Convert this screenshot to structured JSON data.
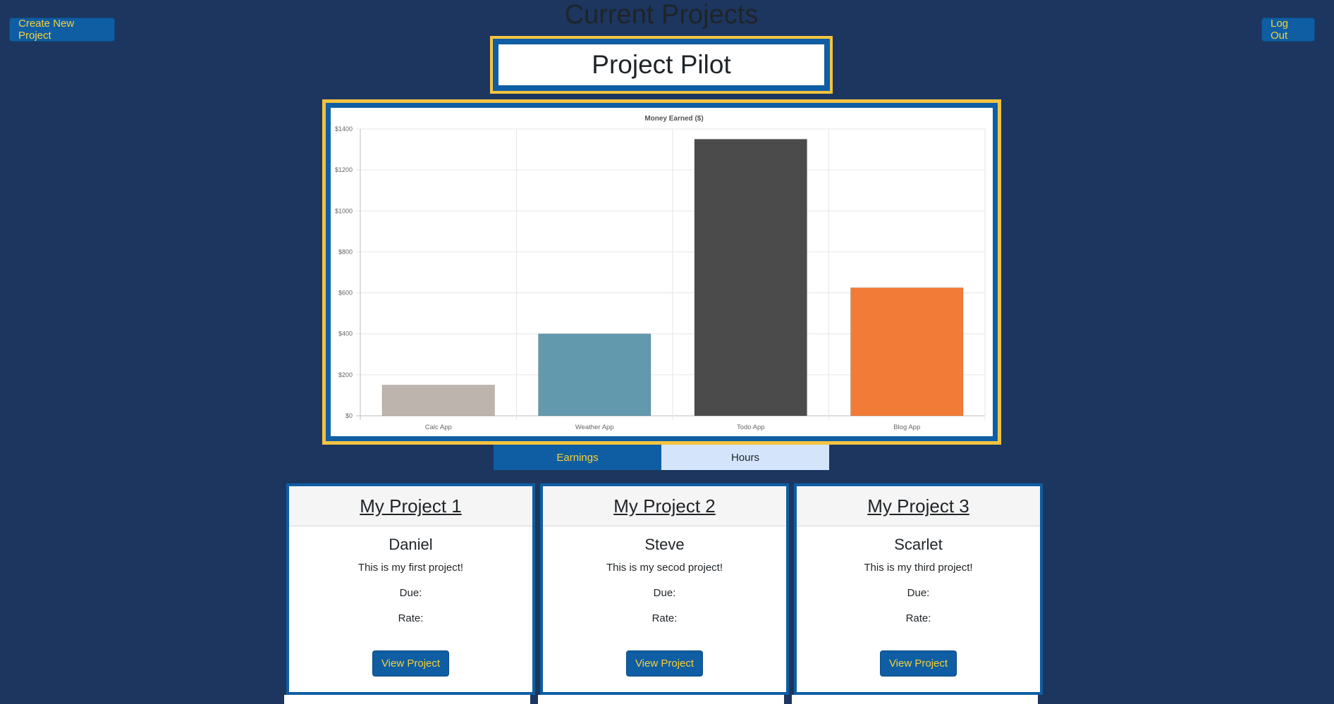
{
  "header": {
    "page_title": "Current Projects",
    "create_button": "Create New Project",
    "logout_button": "Log Out",
    "brand": "Project Pilot"
  },
  "chart_data": {
    "type": "bar",
    "title": "Money Earned ($)",
    "categories": [
      "Calc App",
      "Weather App",
      "Todo App",
      "Blog App"
    ],
    "values": [
      150,
      400,
      1350,
      625
    ],
    "colors": [
      "#bdb5ad",
      "#6299ad",
      "#4b4b4b",
      "#f27c37"
    ],
    "ylim": [
      0,
      1400
    ],
    "yticks": [
      "$0",
      "$200",
      "$400",
      "$600",
      "$800",
      "$1000",
      "$1200",
      "$1400"
    ],
    "grid": true,
    "xlabel": "",
    "ylabel": ""
  },
  "toggles": {
    "earnings": "Earnings",
    "hours": "Hours"
  },
  "projects": [
    {
      "title": "My Project 1",
      "owner": "Daniel",
      "description": "This is my first project!",
      "due": "Due:",
      "rate": "Rate:",
      "button": "View Project"
    },
    {
      "title": "My Project 2",
      "owner": "Steve",
      "description": "This is my secod project!",
      "due": "Due:",
      "rate": "Rate:",
      "button": "View Project"
    },
    {
      "title": "My Project 3",
      "owner": "Scarlet",
      "description": "This is my third project!",
      "due": "Due:",
      "rate": "Rate:",
      "button": "View Project"
    }
  ],
  "theme": {
    "background": "#1c365f",
    "primary": "#0f5ea3",
    "accent": "#f3c33f",
    "button_text": "#f6d13a"
  }
}
